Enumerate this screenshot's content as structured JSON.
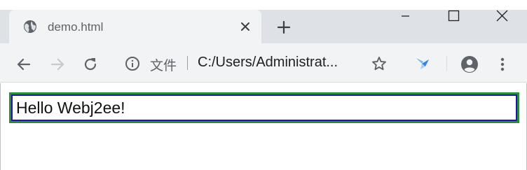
{
  "browser": {
    "tab": {
      "title": "demo.html",
      "icon": "globe-icon"
    },
    "new_tab_icon": "plus-icon",
    "window_controls": [
      "minimize-icon",
      "maximize-icon",
      "close-icon"
    ],
    "address_bar": {
      "scheme_label": "文件",
      "url": "C:/Users/Administrat..."
    }
  },
  "page": {
    "input_value": "Hello Webj2ee!"
  },
  "colors": {
    "tab_strip": "#dee1e6",
    "toolbar": "#f1f3f4",
    "input_outer_border": "#2e8b3e",
    "input_inner_border": "#1a1aa6"
  }
}
